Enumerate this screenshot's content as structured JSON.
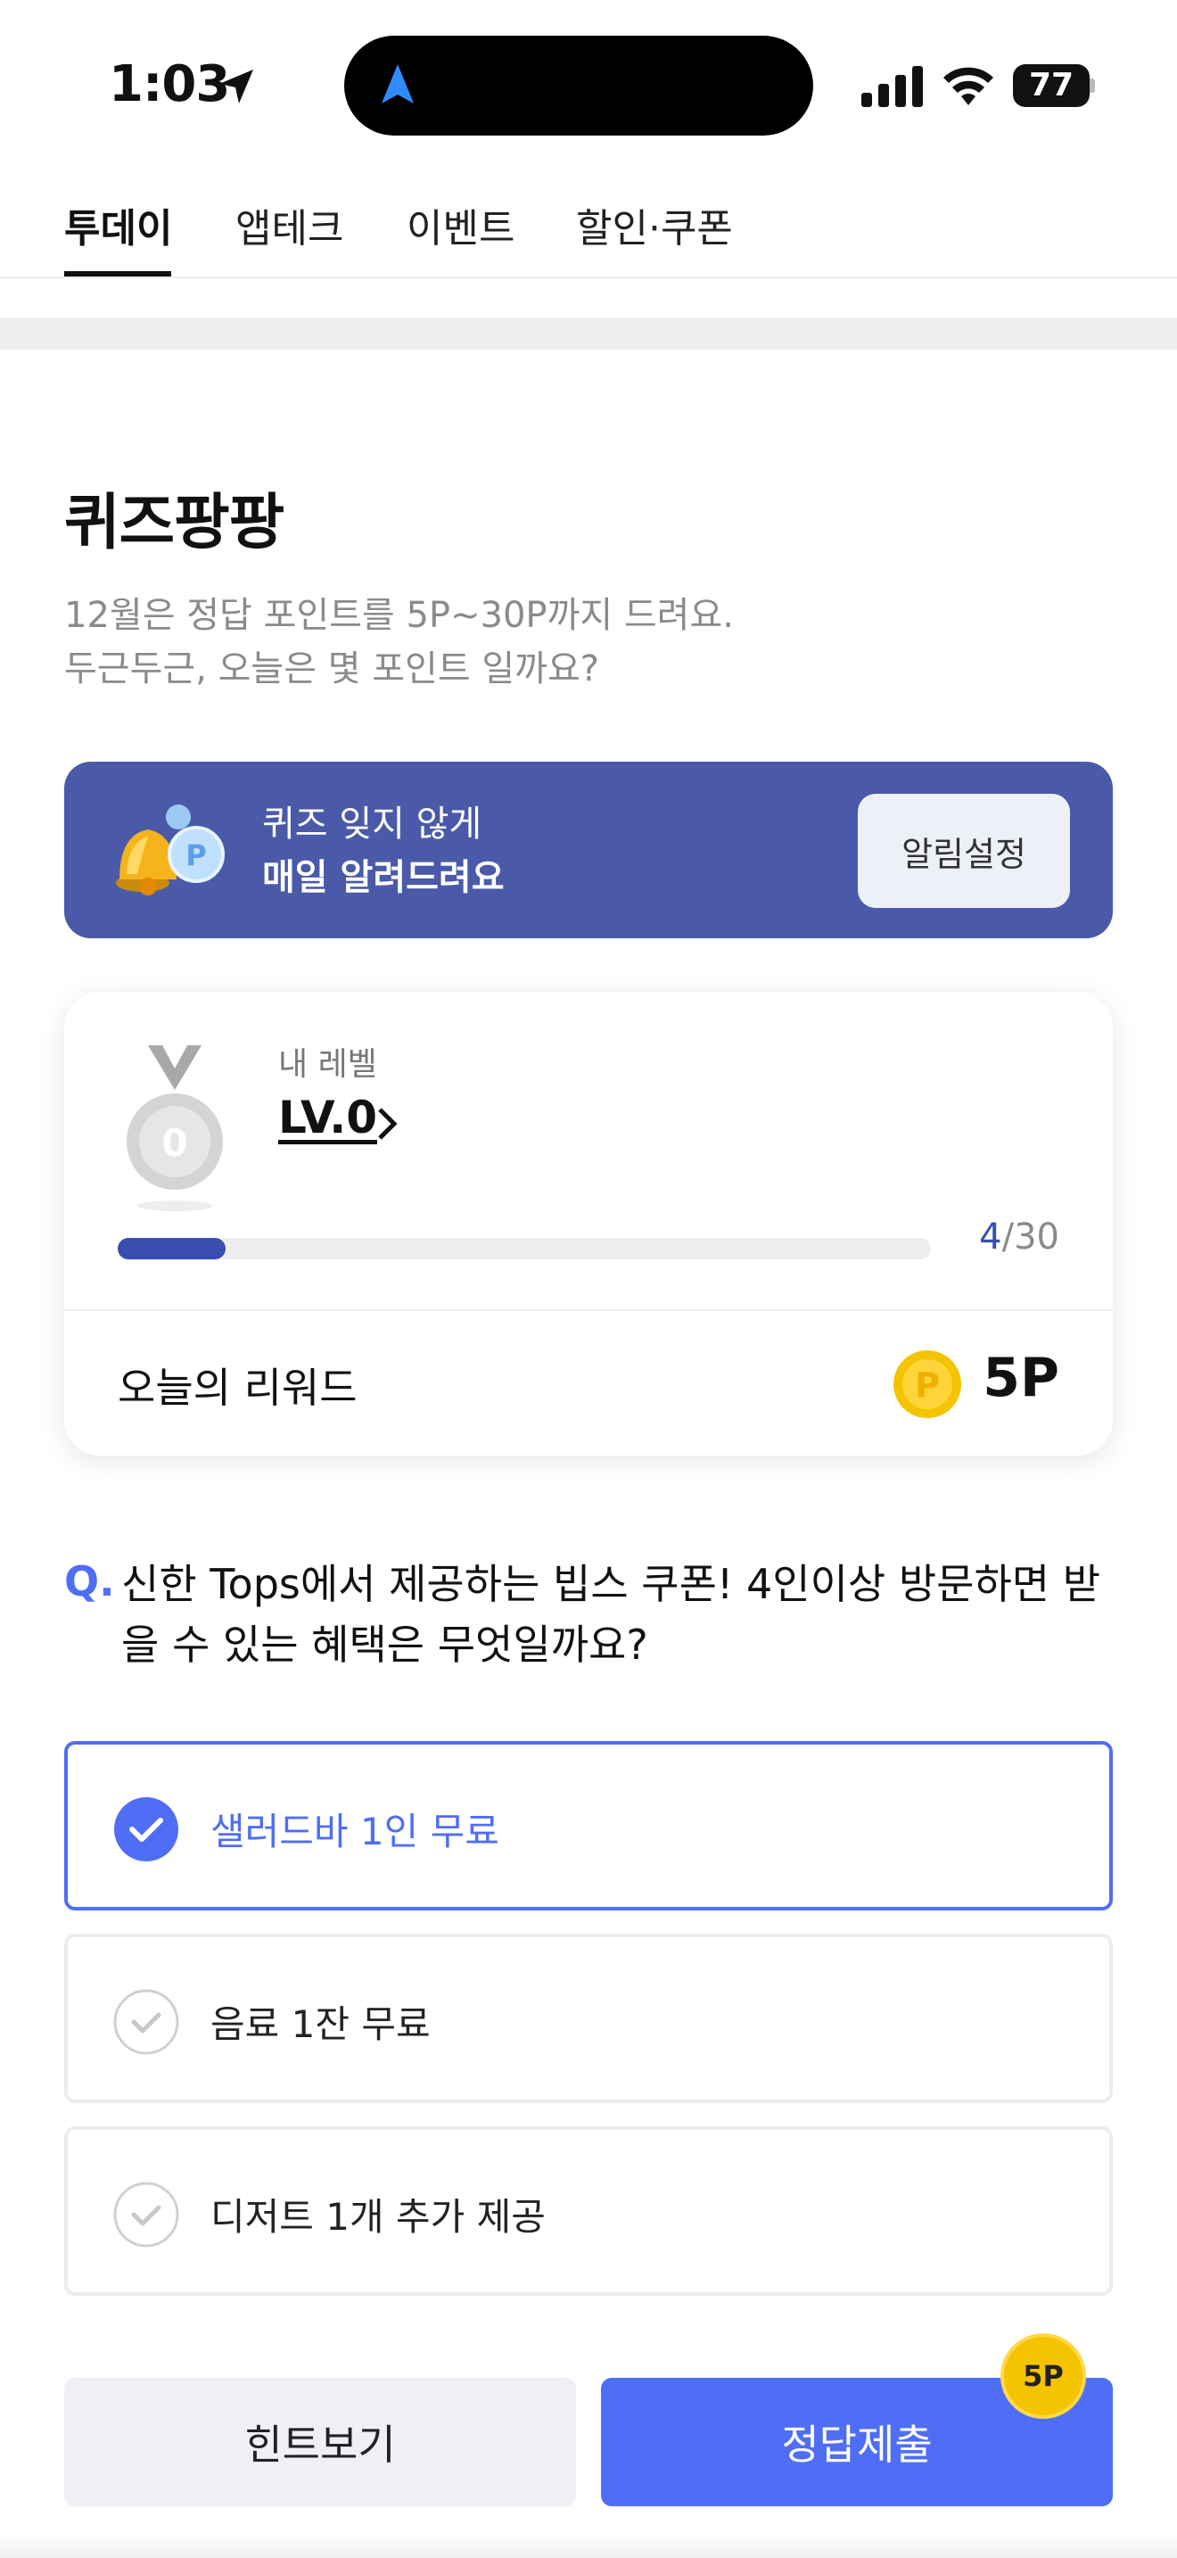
{
  "status_bar": {
    "time": "1:03",
    "battery": "77"
  },
  "tabs": [
    {
      "label": "투데이",
      "active": true
    },
    {
      "label": "앱테크",
      "active": false
    },
    {
      "label": "이벤트",
      "active": false
    },
    {
      "label": "할인·쿠폰",
      "active": false
    }
  ],
  "quiz": {
    "title": "퀴즈팡팡",
    "subtitle_line1": "12월은 정답 포인트를 5P~30P까지 드려요.",
    "subtitle_line2": "두근두근, 오늘은 몇 포인트 일까요?"
  },
  "banner": {
    "line1": "퀴즈 잊지 않게",
    "line2": "매일 알려드려요",
    "button_label": "알림설정",
    "bg_color": "#4a5aa8"
  },
  "level_card": {
    "my_level_label": "내 레벨",
    "level": "LV.0",
    "medal_number": "0",
    "progress_current": "4",
    "progress_total": "/30",
    "progress_fraction": 0.133,
    "reward_label": "오늘의 리워드",
    "reward_value": "5P",
    "coin_letter": "P"
  },
  "question": {
    "prefix": "Q.",
    "text": "신한 Tops에서 제공하는 빕스 쿠폰! 4인이상 방문하면 받을 수 있는 혜택은 무엇일까요?"
  },
  "options": [
    {
      "label": "샐러드바 1인 무료",
      "selected": true
    },
    {
      "label": "음료 1잔 무료",
      "selected": false
    },
    {
      "label": "디저트 1개 추가 제공",
      "selected": false
    }
  ],
  "buttons": {
    "hint_label": "힌트보기",
    "submit_label": "정답제출",
    "submit_badge": "5P"
  },
  "colors": {
    "accent": "#4f6ef5",
    "progress": "#3a4eb0",
    "coin": "#f5c400"
  }
}
